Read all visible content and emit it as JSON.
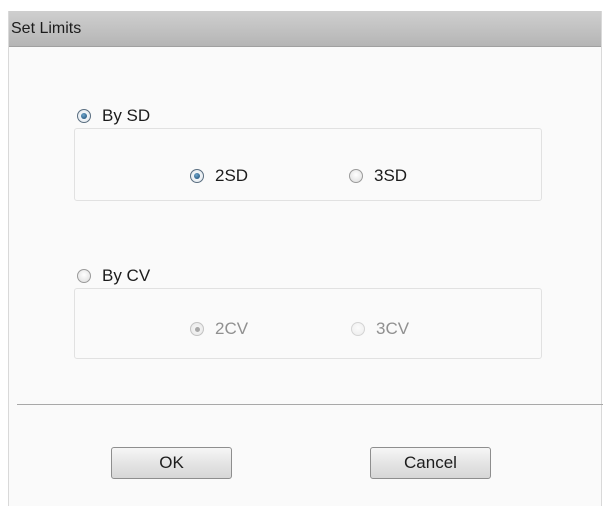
{
  "dialog": {
    "title": "Set Limits"
  },
  "by_sd": {
    "label": "By SD",
    "selected": true,
    "options": [
      {
        "label": "2SD",
        "selected": true,
        "enabled": true
      },
      {
        "label": "3SD",
        "selected": false,
        "enabled": true
      }
    ]
  },
  "by_cv": {
    "label": "By CV",
    "selected": false,
    "options": [
      {
        "label": "2CV",
        "selected": true,
        "enabled": false
      },
      {
        "label": "3CV",
        "selected": false,
        "enabled": false
      }
    ]
  },
  "buttons": {
    "ok_label": "OK",
    "cancel_label": "Cancel"
  },
  "colors": {
    "titlebar": "#c4c4c4",
    "radio_accent": "#1f4f78",
    "disabled_text": "#909090"
  }
}
